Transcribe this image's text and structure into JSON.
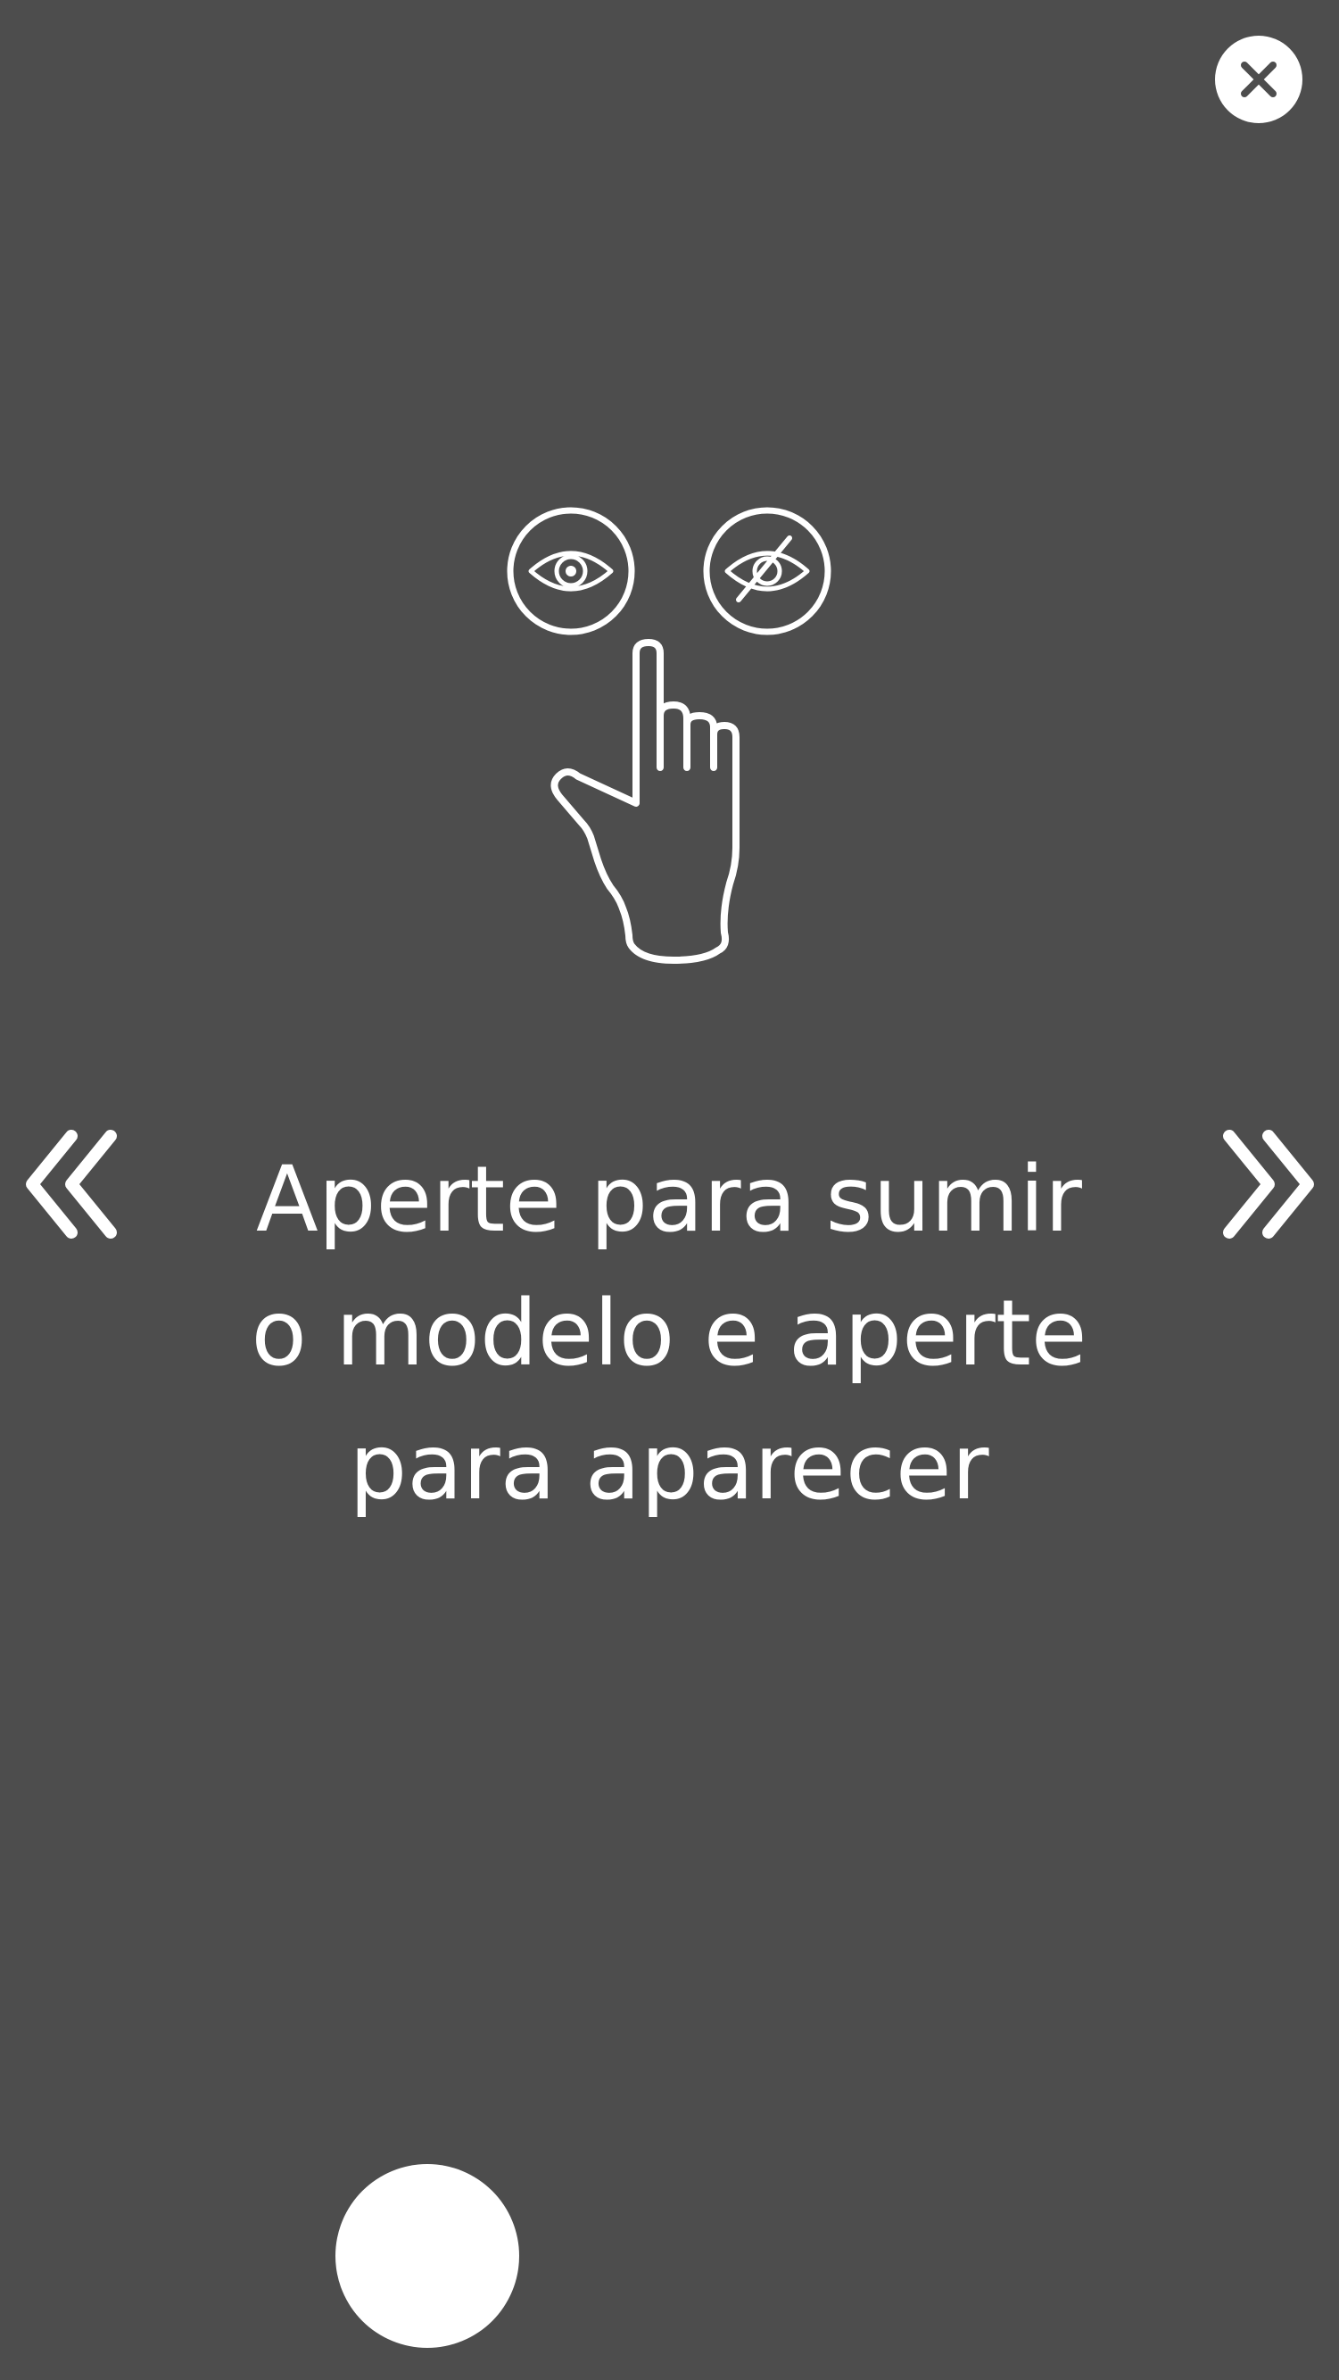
{
  "close_button": {
    "icon": "close-icon"
  },
  "illustration": {
    "icons": [
      "eye-icon",
      "eye-slash-icon",
      "pointing-hand-icon"
    ]
  },
  "navigation": {
    "prev_icon": "double-chevron-left-icon",
    "next_icon": "double-chevron-right-icon"
  },
  "instruction": {
    "line1": "Aperte para sumir",
    "line2": "o modelo e aperte",
    "line3": "para aparecer"
  },
  "shutter": {
    "icon": "capture-button"
  },
  "colors": {
    "background": "#4d4d4d",
    "foreground": "#ffffff"
  }
}
